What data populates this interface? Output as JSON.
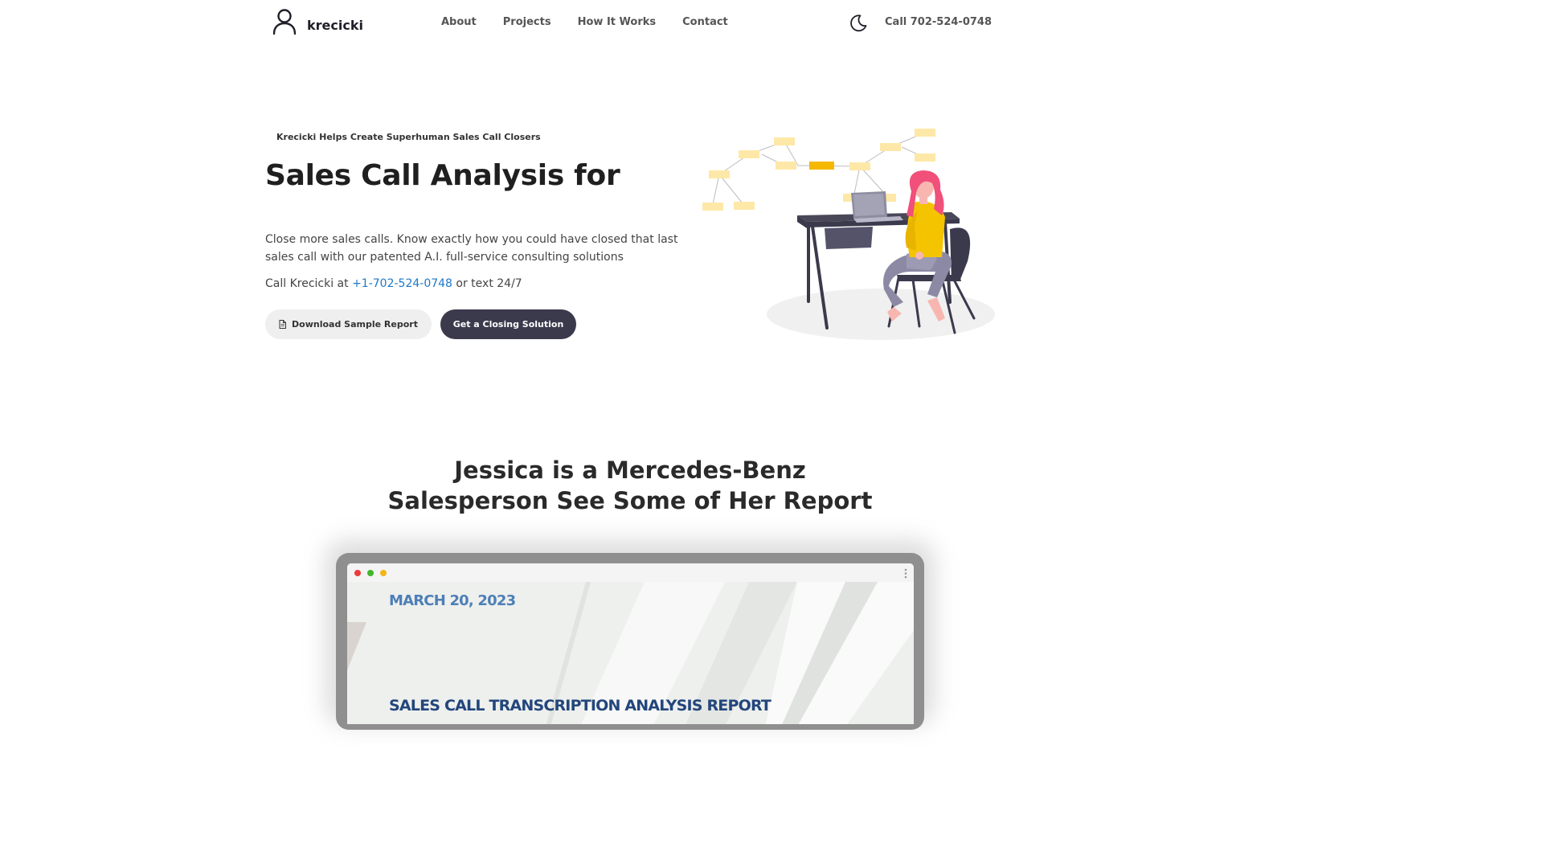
{
  "header": {
    "brand": "krecicki",
    "nav": [
      "About",
      "Projects",
      "How It Works",
      "Contact"
    ],
    "call_label": "Call 702-524-0748",
    "theme_icon": "moon-icon"
  },
  "hero": {
    "tagline": "Krecicki Helps Create Superhuman Sales Call Closers",
    "title": "Sales Call Analysis for",
    "description": "Close more sales calls. Know exactly how you could have closed that last sales call with our patented A.I. full-service consulting solutions",
    "call_prefix": "Call Krecicki at ",
    "phone": "+1-702-524-0748",
    "call_suffix": " or text 24/7",
    "btn_download": "Download Sample Report",
    "btn_closing": "Get a Closing Solution"
  },
  "section": {
    "title_line1": "Jessica is a Mercedes-Benz",
    "title_line2": "Salesperson See Some of Her Report"
  },
  "report": {
    "date": "MARCH 20, 2023",
    "title": "SALES CALL TRANSCRIPTION ANALYSIS REPORT"
  },
  "colors": {
    "accent_dark": "#3b3a4d",
    "link_blue": "#1e78c8",
    "illustration_yellow": "#f5b800",
    "illustration_pink": "#f06292"
  }
}
